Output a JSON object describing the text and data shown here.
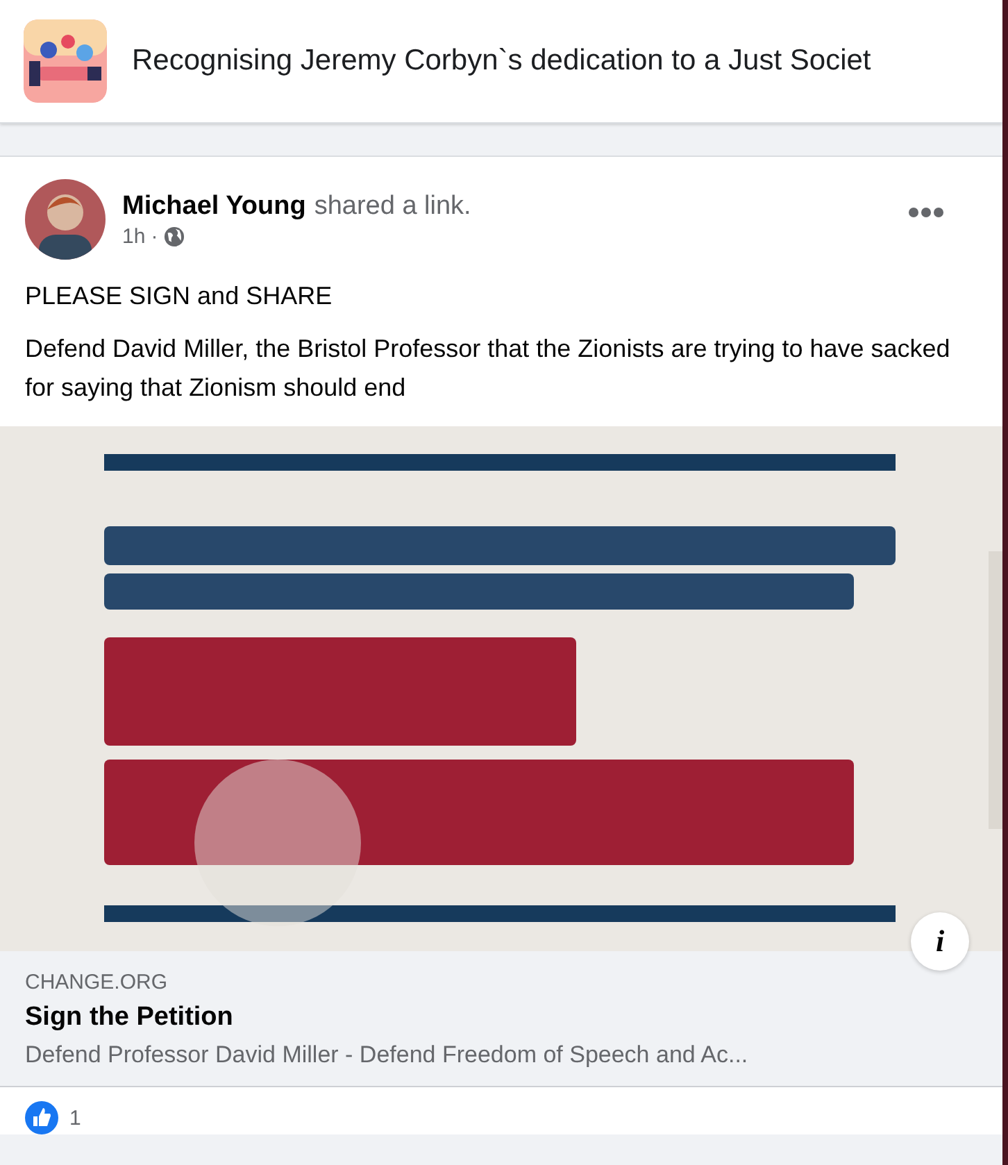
{
  "group": {
    "title": "Recognising Jeremy Corbyn`s dedication to a Just Societ"
  },
  "post": {
    "author": "Michael Young",
    "action": "shared a link.",
    "time": "1h",
    "separator": "·",
    "lines": [
      "PLEASE SIGN and SHARE",
      "Defend David Miller, the Bristol Professor that the Zionists are trying to have sacked for saying that Zionism should end"
    ],
    "link": {
      "info_button": "i",
      "domain": "CHANGE.ORG",
      "title": "Sign the Petition",
      "description": "Defend Professor David Miller - Defend Freedom of Speech and Ac..."
    },
    "reactions": {
      "count": "1"
    }
  }
}
